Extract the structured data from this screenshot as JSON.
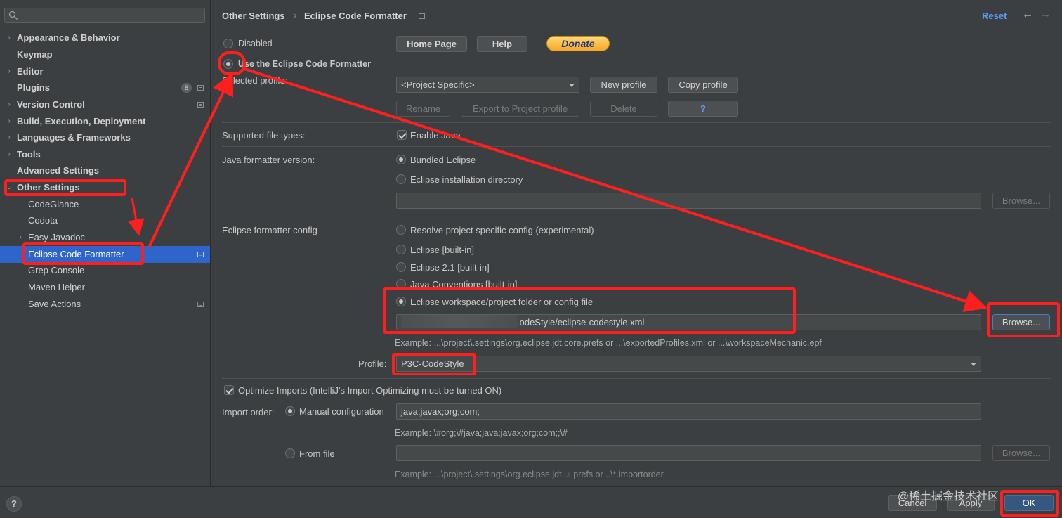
{
  "sidebar": {
    "search": {
      "value": "",
      "placeholder": ""
    },
    "items": [
      {
        "label": "Appearance & Behavior"
      },
      {
        "label": "Keymap"
      },
      {
        "label": "Editor"
      },
      {
        "label": "Plugins",
        "badge": "8"
      },
      {
        "label": "Version Control"
      },
      {
        "label": "Build, Execution, Deployment"
      },
      {
        "label": "Languages & Frameworks"
      },
      {
        "label": "Tools"
      },
      {
        "label": "Advanced Settings"
      },
      {
        "label": "Other Settings"
      },
      {
        "label": "CodeGlance"
      },
      {
        "label": "Codota"
      },
      {
        "label": "Easy Javadoc"
      },
      {
        "label": "Eclipse Code Formatter"
      },
      {
        "label": "Grep Console"
      },
      {
        "label": "Maven Helper"
      },
      {
        "label": "Save Actions"
      }
    ]
  },
  "header": {
    "crumb1": "Other Settings",
    "crumb_sep": "›",
    "crumb2": "Eclipse Code Formatter",
    "reset": "Reset",
    "back": "←",
    "forward": "→"
  },
  "mode": {
    "disabled": "Disabled",
    "use": "Use the Eclipse Code Formatter",
    "selected": "use"
  },
  "buttons": {
    "home_page": "Home Page",
    "help": "Help",
    "donate": "Donate"
  },
  "profile_section": {
    "label": "Selected profile:",
    "combo": "<Project Specific>",
    "new_profile": "New profile",
    "copy_profile": "Copy profile",
    "rename": "Rename",
    "export": "Export to Project profile",
    "delete": "Delete",
    "question": "?"
  },
  "file_types": {
    "label": "Supported file types:",
    "enable_java": "Enable Java"
  },
  "java_version": {
    "label": "Java formatter version:",
    "bundled": "Bundled Eclipse",
    "install_dir": "Eclipse installation directory",
    "dir_value": "",
    "browse": "Browse..."
  },
  "config": {
    "label": "Eclipse formatter config",
    "resolve": "Resolve project specific config (experimental)",
    "builtin": "Eclipse [built-in]",
    "builtin21": "Eclipse 2.1 [built-in]",
    "java_conv": "Java Conventions [built-in]",
    "workspace": "Eclipse workspace/project folder or config file",
    "path_value": ".odeStyle/eclipse-codestyle.xml",
    "browse": "Browse...",
    "example": "Example: ...\\project\\.settings\\org.eclipse.jdt.core.prefs or ...\\exportedProfiles.xml or ...\\workspaceMechanic.epf",
    "profile_label": "Profile:",
    "profile_value": "P3C-CodeStyle"
  },
  "imports": {
    "optimize": "Optimize Imports  (IntelliJ's Import Optimizing must be turned ON)",
    "order_label": "Import order:",
    "manual": "Manual configuration",
    "manual_value": "java;javax;org;com;",
    "example": "Example: \\#org;\\#java;java;javax;org;com;;\\#",
    "from_file": "From file",
    "file_value": "",
    "browse": "Browse...",
    "file_example": "Example: ...\\project\\.settings\\org.eclipse.jdt.ui.prefs or ..\\*.importorder"
  },
  "footer": {
    "help": "?",
    "cancel": "Cancel",
    "apply": "Apply",
    "ok": "OK"
  },
  "watermark": "@稀土掘金技术社区",
  "colors": {
    "accent": "#2f65ca",
    "annotation": "#ff1f1f",
    "link": "#589df6"
  }
}
